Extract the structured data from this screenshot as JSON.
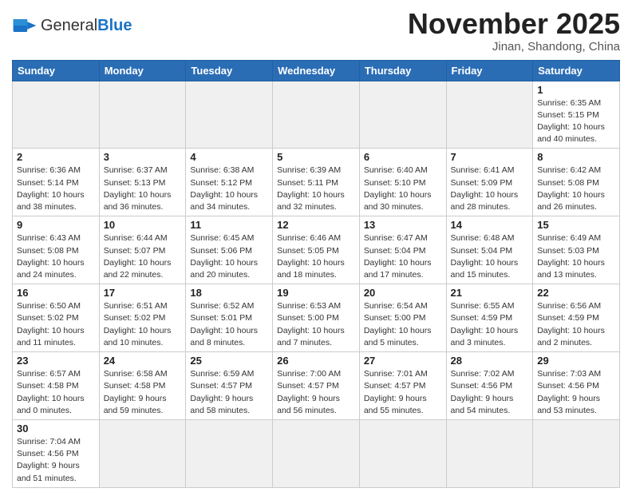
{
  "header": {
    "logo_general": "General",
    "logo_blue": "Blue",
    "month_title": "November 2025",
    "location": "Jinan, Shandong, China"
  },
  "weekdays": [
    "Sunday",
    "Monday",
    "Tuesday",
    "Wednesday",
    "Thursday",
    "Friday",
    "Saturday"
  ],
  "weeks": [
    [
      {
        "day": "",
        "info": ""
      },
      {
        "day": "",
        "info": ""
      },
      {
        "day": "",
        "info": ""
      },
      {
        "day": "",
        "info": ""
      },
      {
        "day": "",
        "info": ""
      },
      {
        "day": "",
        "info": ""
      },
      {
        "day": "1",
        "info": "Sunrise: 6:35 AM\nSunset: 5:15 PM\nDaylight: 10 hours\nand 40 minutes."
      }
    ],
    [
      {
        "day": "2",
        "info": "Sunrise: 6:36 AM\nSunset: 5:14 PM\nDaylight: 10 hours\nand 38 minutes."
      },
      {
        "day": "3",
        "info": "Sunrise: 6:37 AM\nSunset: 5:13 PM\nDaylight: 10 hours\nand 36 minutes."
      },
      {
        "day": "4",
        "info": "Sunrise: 6:38 AM\nSunset: 5:12 PM\nDaylight: 10 hours\nand 34 minutes."
      },
      {
        "day": "5",
        "info": "Sunrise: 6:39 AM\nSunset: 5:11 PM\nDaylight: 10 hours\nand 32 minutes."
      },
      {
        "day": "6",
        "info": "Sunrise: 6:40 AM\nSunset: 5:10 PM\nDaylight: 10 hours\nand 30 minutes."
      },
      {
        "day": "7",
        "info": "Sunrise: 6:41 AM\nSunset: 5:09 PM\nDaylight: 10 hours\nand 28 minutes."
      },
      {
        "day": "8",
        "info": "Sunrise: 6:42 AM\nSunset: 5:08 PM\nDaylight: 10 hours\nand 26 minutes."
      }
    ],
    [
      {
        "day": "9",
        "info": "Sunrise: 6:43 AM\nSunset: 5:08 PM\nDaylight: 10 hours\nand 24 minutes."
      },
      {
        "day": "10",
        "info": "Sunrise: 6:44 AM\nSunset: 5:07 PM\nDaylight: 10 hours\nand 22 minutes."
      },
      {
        "day": "11",
        "info": "Sunrise: 6:45 AM\nSunset: 5:06 PM\nDaylight: 10 hours\nand 20 minutes."
      },
      {
        "day": "12",
        "info": "Sunrise: 6:46 AM\nSunset: 5:05 PM\nDaylight: 10 hours\nand 18 minutes."
      },
      {
        "day": "13",
        "info": "Sunrise: 6:47 AM\nSunset: 5:04 PM\nDaylight: 10 hours\nand 17 minutes."
      },
      {
        "day": "14",
        "info": "Sunrise: 6:48 AM\nSunset: 5:04 PM\nDaylight: 10 hours\nand 15 minutes."
      },
      {
        "day": "15",
        "info": "Sunrise: 6:49 AM\nSunset: 5:03 PM\nDaylight: 10 hours\nand 13 minutes."
      }
    ],
    [
      {
        "day": "16",
        "info": "Sunrise: 6:50 AM\nSunset: 5:02 PM\nDaylight: 10 hours\nand 11 minutes."
      },
      {
        "day": "17",
        "info": "Sunrise: 6:51 AM\nSunset: 5:02 PM\nDaylight: 10 hours\nand 10 minutes."
      },
      {
        "day": "18",
        "info": "Sunrise: 6:52 AM\nSunset: 5:01 PM\nDaylight: 10 hours\nand 8 minutes."
      },
      {
        "day": "19",
        "info": "Sunrise: 6:53 AM\nSunset: 5:00 PM\nDaylight: 10 hours\nand 7 minutes."
      },
      {
        "day": "20",
        "info": "Sunrise: 6:54 AM\nSunset: 5:00 PM\nDaylight: 10 hours\nand 5 minutes."
      },
      {
        "day": "21",
        "info": "Sunrise: 6:55 AM\nSunset: 4:59 PM\nDaylight: 10 hours\nand 3 minutes."
      },
      {
        "day": "22",
        "info": "Sunrise: 6:56 AM\nSunset: 4:59 PM\nDaylight: 10 hours\nand 2 minutes."
      }
    ],
    [
      {
        "day": "23",
        "info": "Sunrise: 6:57 AM\nSunset: 4:58 PM\nDaylight: 10 hours\nand 0 minutes."
      },
      {
        "day": "24",
        "info": "Sunrise: 6:58 AM\nSunset: 4:58 PM\nDaylight: 9 hours\nand 59 minutes."
      },
      {
        "day": "25",
        "info": "Sunrise: 6:59 AM\nSunset: 4:57 PM\nDaylight: 9 hours\nand 58 minutes."
      },
      {
        "day": "26",
        "info": "Sunrise: 7:00 AM\nSunset: 4:57 PM\nDaylight: 9 hours\nand 56 minutes."
      },
      {
        "day": "27",
        "info": "Sunrise: 7:01 AM\nSunset: 4:57 PM\nDaylight: 9 hours\nand 55 minutes."
      },
      {
        "day": "28",
        "info": "Sunrise: 7:02 AM\nSunset: 4:56 PM\nDaylight: 9 hours\nand 54 minutes."
      },
      {
        "day": "29",
        "info": "Sunrise: 7:03 AM\nSunset: 4:56 PM\nDaylight: 9 hours\nand 53 minutes."
      }
    ],
    [
      {
        "day": "30",
        "info": "Sunrise: 7:04 AM\nSunset: 4:56 PM\nDaylight: 9 hours\nand 51 minutes."
      },
      {
        "day": "",
        "info": ""
      },
      {
        "day": "",
        "info": ""
      },
      {
        "day": "",
        "info": ""
      },
      {
        "day": "",
        "info": ""
      },
      {
        "day": "",
        "info": ""
      },
      {
        "day": "",
        "info": ""
      }
    ]
  ]
}
